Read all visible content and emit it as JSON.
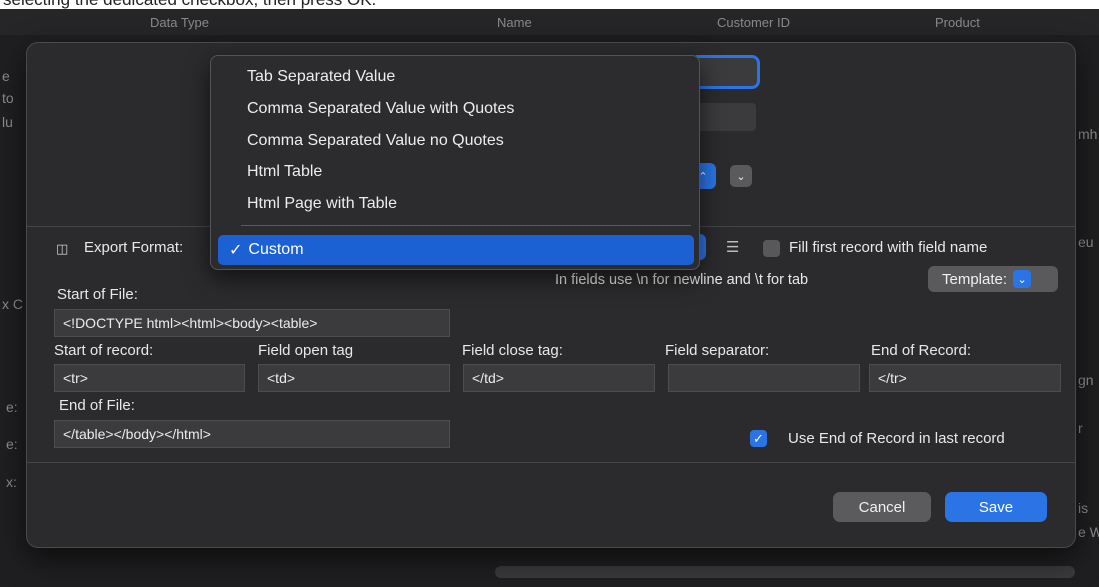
{
  "caption": "selecting the dedicated checkbox, then press OK.",
  "background": {
    "columns": [
      "Data Type",
      "Name",
      "Customer ID",
      "Product"
    ],
    "left_edge": [
      "e",
      "to",
      "lu",
      "x C",
      "e:",
      "e:",
      "x:"
    ],
    "right_edge": [
      "mh",
      "eu",
      "gn",
      "r",
      "is",
      "e W"
    ]
  },
  "format_menu": {
    "items": [
      "Tab Separated Value",
      "Comma Separated Value with Quotes",
      "Comma Separated Value no Quotes",
      "Html Table",
      "Html Page with Table"
    ],
    "selected": "Custom"
  },
  "export_format": {
    "label": "Export Format:",
    "icon": "columns-icon"
  },
  "fill_first": {
    "icon": "list-icon",
    "label": "Fill first record with field name",
    "checked": false
  },
  "hint": "In fields use \\n for newline and \\t for tab",
  "template_button": "Template:",
  "fields": {
    "start_of_file": {
      "label": "Start of File:",
      "value": "<!DOCTYPE html><html><body><table>"
    },
    "start_of_record": {
      "label": "Start of record:",
      "value": "<tr>"
    },
    "field_open": {
      "label": "Field open tag",
      "value": "<td>"
    },
    "field_close": {
      "label": "Field close tag:",
      "value": "</td>"
    },
    "field_separator": {
      "label": "Field separator:",
      "value": ""
    },
    "end_of_record": {
      "label": "End of Record:",
      "value": "</tr>"
    },
    "end_of_file": {
      "label": "End of File:",
      "value": "</table></body></html>"
    }
  },
  "use_end_of_record": {
    "label": "Use End of Record in last record",
    "checked": true
  },
  "buttons": {
    "cancel": "Cancel",
    "save": "Save"
  },
  "colors": {
    "accent": "#2a74e6",
    "dialog": "#2b2b2d",
    "field": "#3b3b3d"
  }
}
